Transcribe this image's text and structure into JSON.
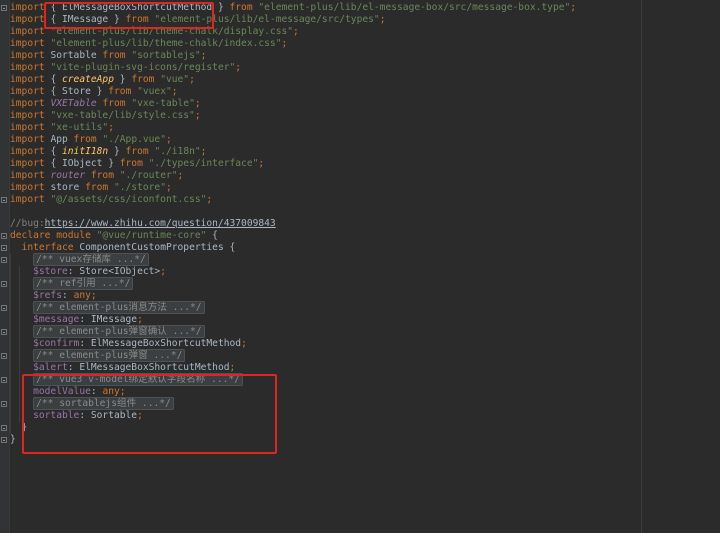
{
  "code": {
    "lines": [
      [
        [
          "kw",
          "import "
        ],
        [
          "",
          "{ ElMessageBoxShortcutMethod } "
        ],
        [
          "kw",
          "from "
        ],
        [
          "str",
          "\"element-plus/lib/el-message-box/src/message-box.type\""
        ],
        [
          "kw",
          ";"
        ]
      ],
      [
        [
          "kw",
          "import "
        ],
        [
          "",
          "{ IMessage } "
        ],
        [
          "kw",
          "from "
        ],
        [
          "str",
          "\"element-plus/lib/el-message/src/types\""
        ],
        [
          "kw",
          ";"
        ]
      ],
      [
        [
          "kw",
          "import "
        ],
        [
          "str",
          "\"element-plus/lib/theme-chalk/display.css\""
        ],
        [
          "kw",
          ";"
        ]
      ],
      [
        [
          "kw",
          "import "
        ],
        [
          "str",
          "\"element-plus/lib/theme-chalk/index.css\""
        ],
        [
          "kw",
          ";"
        ]
      ],
      [
        [
          "kw",
          "import "
        ],
        [
          "",
          "Sortable "
        ],
        [
          "kw",
          "from "
        ],
        [
          "str",
          "\"sortablejs\""
        ],
        [
          "kw",
          ";"
        ]
      ],
      [
        [
          "kw",
          "import "
        ],
        [
          "str",
          "\"vite-plugin-svg-icons/register\""
        ],
        [
          "kw",
          ";"
        ]
      ],
      [
        [
          "kw",
          "import "
        ],
        [
          "",
          "{ "
        ],
        [
          "fn",
          "createApp"
        ],
        [
          "",
          " } "
        ],
        [
          "kw",
          "from "
        ],
        [
          "str",
          "\"vue\""
        ],
        [
          "kw",
          ";"
        ]
      ],
      [
        [
          "kw",
          "import "
        ],
        [
          "",
          "{ Store } "
        ],
        [
          "kw",
          "from "
        ],
        [
          "str",
          "\"vuex\""
        ],
        [
          "kw",
          ";"
        ]
      ],
      [
        [
          "kw",
          "import "
        ],
        [
          "itl",
          "VXETable"
        ],
        [
          "",
          " "
        ],
        [
          "kw",
          "from "
        ],
        [
          "str",
          "\"vxe-table\""
        ],
        [
          "kw",
          ";"
        ]
      ],
      [
        [
          "kw",
          "import "
        ],
        [
          "str",
          "\"vxe-table/lib/style.css\""
        ],
        [
          "kw",
          ";"
        ]
      ],
      [
        [
          "kw",
          "import "
        ],
        [
          "str",
          "\"xe-utils\""
        ],
        [
          "kw",
          ";"
        ]
      ],
      [
        [
          "kw",
          "import "
        ],
        [
          "",
          "App "
        ],
        [
          "kw",
          "from "
        ],
        [
          "str",
          "\"./App.vue\""
        ],
        [
          "kw",
          ";"
        ]
      ],
      [
        [
          "kw",
          "import "
        ],
        [
          "",
          "{ "
        ],
        [
          "fn",
          "initI18n"
        ],
        [
          "",
          " } "
        ],
        [
          "kw",
          "from "
        ],
        [
          "str",
          "\"./i18n\""
        ],
        [
          "kw",
          ";"
        ]
      ],
      [
        [
          "kw",
          "import "
        ],
        [
          "",
          "{ IObject } "
        ],
        [
          "kw",
          "from "
        ],
        [
          "str",
          "\"./types/interface\""
        ],
        [
          "kw",
          ";"
        ]
      ],
      [
        [
          "kw",
          "import "
        ],
        [
          "itl",
          "router"
        ],
        [
          "",
          " "
        ],
        [
          "kw",
          "from "
        ],
        [
          "str",
          "\"./router\""
        ],
        [
          "kw",
          ";"
        ]
      ],
      [
        [
          "kw",
          "import "
        ],
        [
          "",
          "store "
        ],
        [
          "kw",
          "from "
        ],
        [
          "str",
          "\"./store\""
        ],
        [
          "kw",
          ";"
        ]
      ],
      [
        [
          "kw",
          "import "
        ],
        [
          "str",
          "\"@/assets/css/iconfont.css\""
        ],
        [
          "kw",
          ";"
        ]
      ],
      [],
      [
        [
          "cmt",
          "//bug:"
        ],
        [
          "url",
          "https://www.zhihu.com/question/437009843"
        ]
      ],
      [
        [
          "kw",
          "declare module "
        ],
        [
          "str",
          "\"@vue/runtime-core\""
        ],
        [
          "",
          " {"
        ]
      ],
      [
        [
          "",
          "  "
        ],
        [
          "kw",
          "interface "
        ],
        [
          "",
          "ComponentCustomProperties {"
        ]
      ],
      [
        [
          "",
          "    "
        ],
        [
          "fold",
          "/** vuex存储库 ...*/"
        ]
      ],
      [
        [
          "",
          "    "
        ],
        [
          "prop",
          "$store"
        ],
        [
          "",
          ": Store<IObject>"
        ],
        [
          "kw",
          ";"
        ]
      ],
      [
        [
          "",
          "    "
        ],
        [
          "fold",
          "/** ref引用 ...*/"
        ]
      ],
      [
        [
          "",
          "    "
        ],
        [
          "prop",
          "$refs"
        ],
        [
          "",
          ": "
        ],
        [
          "kw",
          "any"
        ],
        [
          "kw",
          ";"
        ]
      ],
      [
        [
          "",
          "    "
        ],
        [
          "fold",
          "/** element-plus消息方法 ...*/"
        ]
      ],
      [
        [
          "",
          "    "
        ],
        [
          "prop",
          "$message"
        ],
        [
          "",
          ": IMessage"
        ],
        [
          "kw",
          ";"
        ]
      ],
      [
        [
          "",
          "    "
        ],
        [
          "fold",
          "/** element-plus弹窗确认 ...*/"
        ]
      ],
      [
        [
          "",
          "    "
        ],
        [
          "prop",
          "$confirm"
        ],
        [
          "",
          ": ElMessageBoxShortcutMethod"
        ],
        [
          "kw",
          ";"
        ]
      ],
      [
        [
          "",
          "    "
        ],
        [
          "fold",
          "/** element-plus弹窗 ...*/"
        ]
      ],
      [
        [
          "",
          "    "
        ],
        [
          "prop",
          "$alert"
        ],
        [
          "",
          ": ElMessageBoxShortcutMethod"
        ],
        [
          "kw",
          ";"
        ]
      ],
      [
        [
          "",
          "    "
        ],
        [
          "fold",
          "/** vue3 v-model绑定默认字段名称 ...*/"
        ]
      ],
      [
        [
          "",
          "    "
        ],
        [
          "prop",
          "modelValue"
        ],
        [
          "",
          ": "
        ],
        [
          "kw",
          "any"
        ],
        [
          "kw",
          ";"
        ]
      ],
      [
        [
          "",
          "    "
        ],
        [
          "fold",
          "/** sortablejs组件 ...*/"
        ]
      ],
      [
        [
          "",
          "    "
        ],
        [
          "prop",
          "sortable"
        ],
        [
          "",
          ": Sortable"
        ],
        [
          "kw",
          ";"
        ]
      ],
      [
        [
          "",
          "  }"
        ]
      ],
      [
        [
          "",
          "}"
        ]
      ]
    ]
  },
  "colors": {
    "background": "#2b2b2b",
    "keyword": "#cc7832",
    "string": "#6a8759",
    "comment": "#808080",
    "property": "#9876aa",
    "function": "#ffc66d",
    "highlight_box": "#e0251e"
  }
}
